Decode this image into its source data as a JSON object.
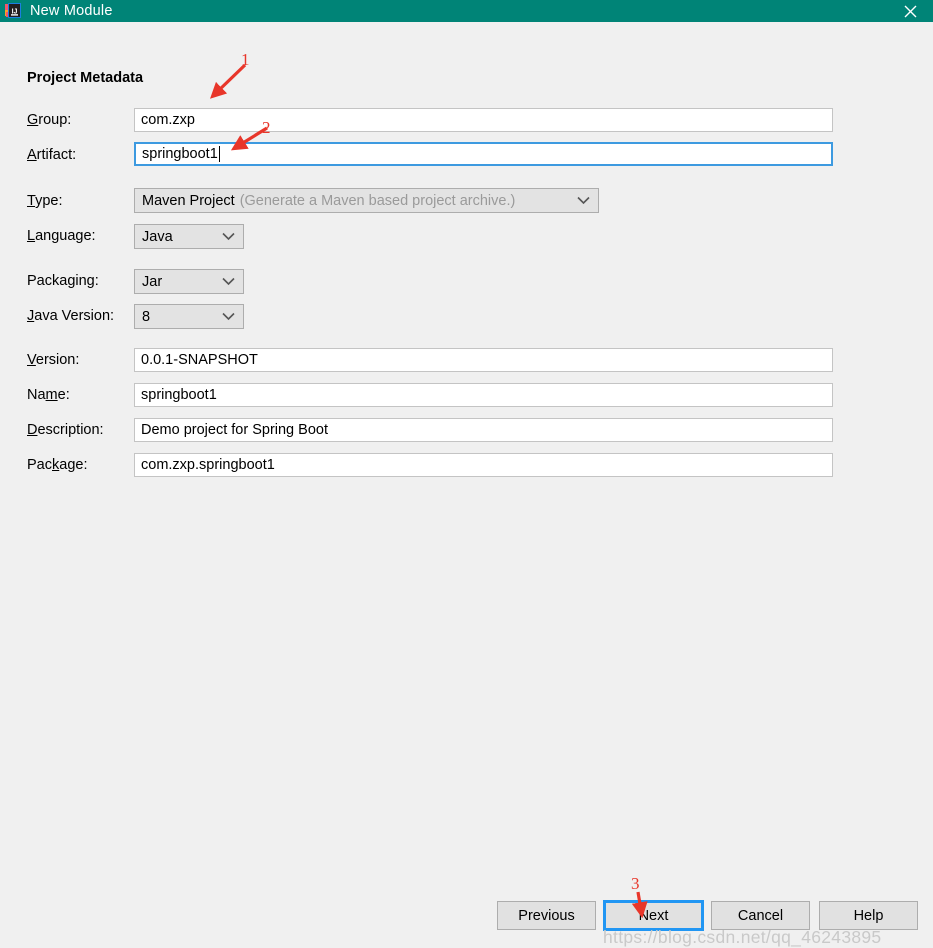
{
  "window": {
    "title": "New Module",
    "icon": "intellij-idea-icon",
    "close_label": "×",
    "titlebar_color": "#008477",
    "background_color": "#f0f0f0"
  },
  "form": {
    "heading": "Project Metadata",
    "fields": [
      {
        "label": "Group:",
        "mnemonic": "G",
        "value": "com.zxp",
        "kind": "text",
        "focused": false
      },
      {
        "label": "Artifact:",
        "mnemonic": "A",
        "value": "springboot1",
        "kind": "text",
        "focused": true
      },
      {
        "label": "Type:",
        "mnemonic": "T",
        "value": "Maven Project",
        "hint": "(Generate a Maven based project archive.)",
        "kind": "combo"
      },
      {
        "label": "Language:",
        "mnemonic": "L",
        "value": "Java",
        "kind": "combo"
      },
      {
        "label": "Packaging:",
        "mnemonic": "g",
        "value": "Jar",
        "kind": "combo"
      },
      {
        "label": "Java Version:",
        "mnemonic": "J",
        "value": "8",
        "kind": "combo"
      },
      {
        "label": "Version:",
        "mnemonic": "V",
        "value": "0.0.1-SNAPSHOT",
        "kind": "text",
        "focused": false
      },
      {
        "label": "Name:",
        "mnemonic": "m",
        "value": "springboot1",
        "kind": "text",
        "focused": false
      },
      {
        "label": "Description:",
        "mnemonic": "D",
        "value": "Demo project for Spring Boot",
        "kind": "text",
        "focused": false
      },
      {
        "label": "Package:",
        "mnemonic": "k",
        "value": "com.zxp.springboot1",
        "kind": "text",
        "focused": false
      }
    ]
  },
  "buttons": {
    "previous": "Previous",
    "next": "Next",
    "cancel": "Cancel",
    "help": "Help",
    "focused": "Next",
    "focus_color": "#2196f3"
  },
  "annotations": {
    "color": "#e8362a",
    "items": [
      {
        "number": "1",
        "target": "group-field"
      },
      {
        "number": "2",
        "target": "artifact-field"
      },
      {
        "number": "3",
        "target": "next-button"
      }
    ]
  },
  "watermark": {
    "text": "https://blog.csdn.net/qq_46243895"
  }
}
